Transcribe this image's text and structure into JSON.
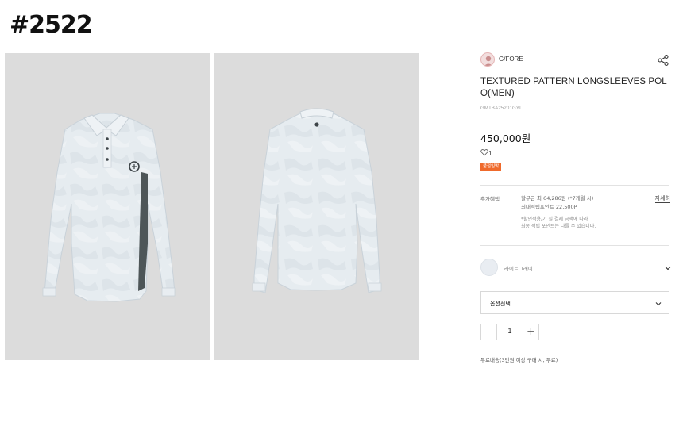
{
  "tag_number": "#2522",
  "images": {
    "front_alt": "front view shirt",
    "back_alt": "back view shirt",
    "background_color": "#dcdcdc",
    "shirt_color": "#e8edf1"
  },
  "brand": {
    "name": "G/FORE",
    "share_icon": "share-icon"
  },
  "product": {
    "title": "TEXTURED PATTERN LONGSLEEVES POLO(MEN)",
    "code": "GMTBA25201GYL",
    "price": "450,000원",
    "likes": "1",
    "badge": "품절임박"
  },
  "benefits": {
    "label": "추가혜택",
    "installment": "할부금 최 64,286원 (*7개월 시)",
    "points": "최대적립포인트 22,500P",
    "note_line1": "*할인적용/기 실 결제 금액에 따라",
    "note_line2": "최종 적립 포인트는 다를 수 있습니다.",
    "detail_link": "자세히"
  },
  "color_option": {
    "name": "라이트그레이",
    "swatch_color": "#e9edf2"
  },
  "option_select": {
    "placeholder": "옵션선택"
  },
  "quantity": {
    "minus": "−",
    "value": "1",
    "plus": "+"
  },
  "shipping": "무료배송(3만원 이상 구매 시, 무료)",
  "colors": {
    "accent_orange": "#ef6a2c"
  }
}
